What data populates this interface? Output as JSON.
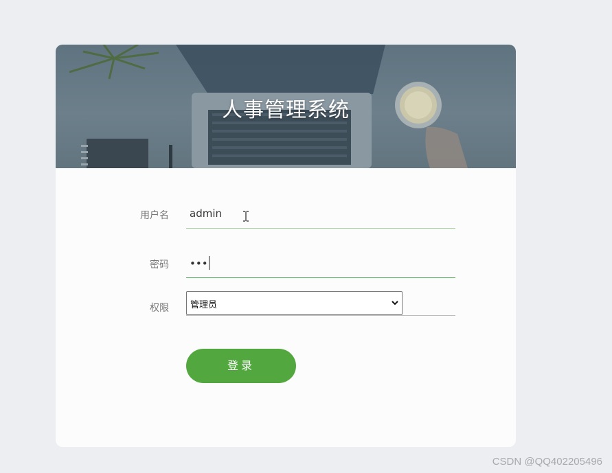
{
  "banner": {
    "title": "人事管理系统"
  },
  "form": {
    "username": {
      "label": "用户名",
      "value": "admin"
    },
    "password": {
      "label": "密码",
      "masked_value": "•••"
    },
    "role": {
      "label": "权限",
      "selected": "管理员"
    },
    "login_label": "登录"
  },
  "watermark": "CSDN @QQ402205496",
  "colors": {
    "accent": "#52a83f",
    "active_underline": "#5cb85c",
    "inactive_underline": "#b8bcbf",
    "page_bg": "#eceef1"
  }
}
